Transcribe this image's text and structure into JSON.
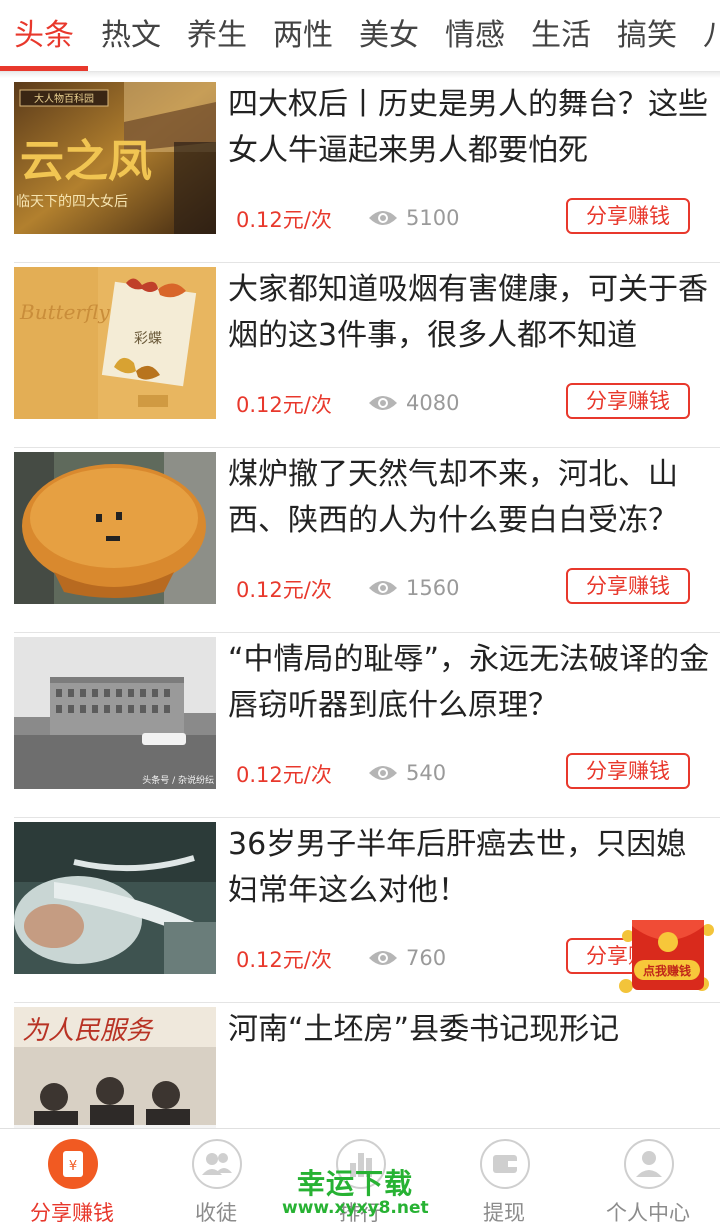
{
  "tabs": [
    {
      "label": "头条",
      "active": true
    },
    {
      "label": "热文"
    },
    {
      "label": "养生"
    },
    {
      "label": "两性"
    },
    {
      "label": "美女"
    },
    {
      "label": "情感"
    },
    {
      "label": "生活"
    },
    {
      "label": "搞笑"
    },
    {
      "label": "八"
    }
  ],
  "articles": [
    {
      "title": "四大权后丨历史是男人的舞台？这些女人牛逼起来男人都要怕死",
      "price": "0.12元/次",
      "views": "5100",
      "share_label": "分享赚钱",
      "thumb_caption": "临天下的四大女后",
      "thumb_title": "云之凤",
      "thumb_banner": "大人物百科园"
    },
    {
      "title": "大家都知道吸烟有害健康，可关于香烟的这3件事，很多人都不知道",
      "price": "0.12元/次",
      "views": "4080",
      "share_label": "分享赚钱",
      "thumb_text": "Butterfly",
      "thumb_badge": "彩蝶"
    },
    {
      "title": "煤炉撤了天然气却不来，河北、山西、陕西的人为什么要白白受冻？",
      "price": "0.12元/次",
      "views": "1560",
      "share_label": "分享赚钱"
    },
    {
      "title": "“中情局的耻辱”，永远无法破译的金唇窃听器到底什么原理？",
      "price": "0.12元/次",
      "views": "540",
      "share_label": "分享赚钱",
      "thumb_caption": "头条号 / 杂说纷纭"
    },
    {
      "title": "36岁男子半年后肝癌去世，只因媳妇常年这么对他！",
      "price": "0.12元/次",
      "views": "760",
      "share_label": "分享赚钱"
    },
    {
      "title": "河南“土坯房”县委书记现形记",
      "thumb_banner": "为人民服务"
    }
  ],
  "floating": {
    "label": "点我赚钱"
  },
  "bottom_nav": [
    {
      "label": "分享赚钱",
      "icon": "wallet-icon",
      "active": true
    },
    {
      "label": "收徒",
      "icon": "users-icon"
    },
    {
      "label": "排行",
      "icon": "bar-chart-icon"
    },
    {
      "label": "提现",
      "icon": "withdraw-wallet-icon"
    },
    {
      "label": "个人中心",
      "icon": "person-icon"
    }
  ],
  "watermark": {
    "line1": "幸运下载",
    "line2": "www.xyxy8.net"
  },
  "colors": {
    "accent": "#e8382c",
    "text": "#222222",
    "muted": "#9a9a9a",
    "watermark": "#27b233"
  }
}
